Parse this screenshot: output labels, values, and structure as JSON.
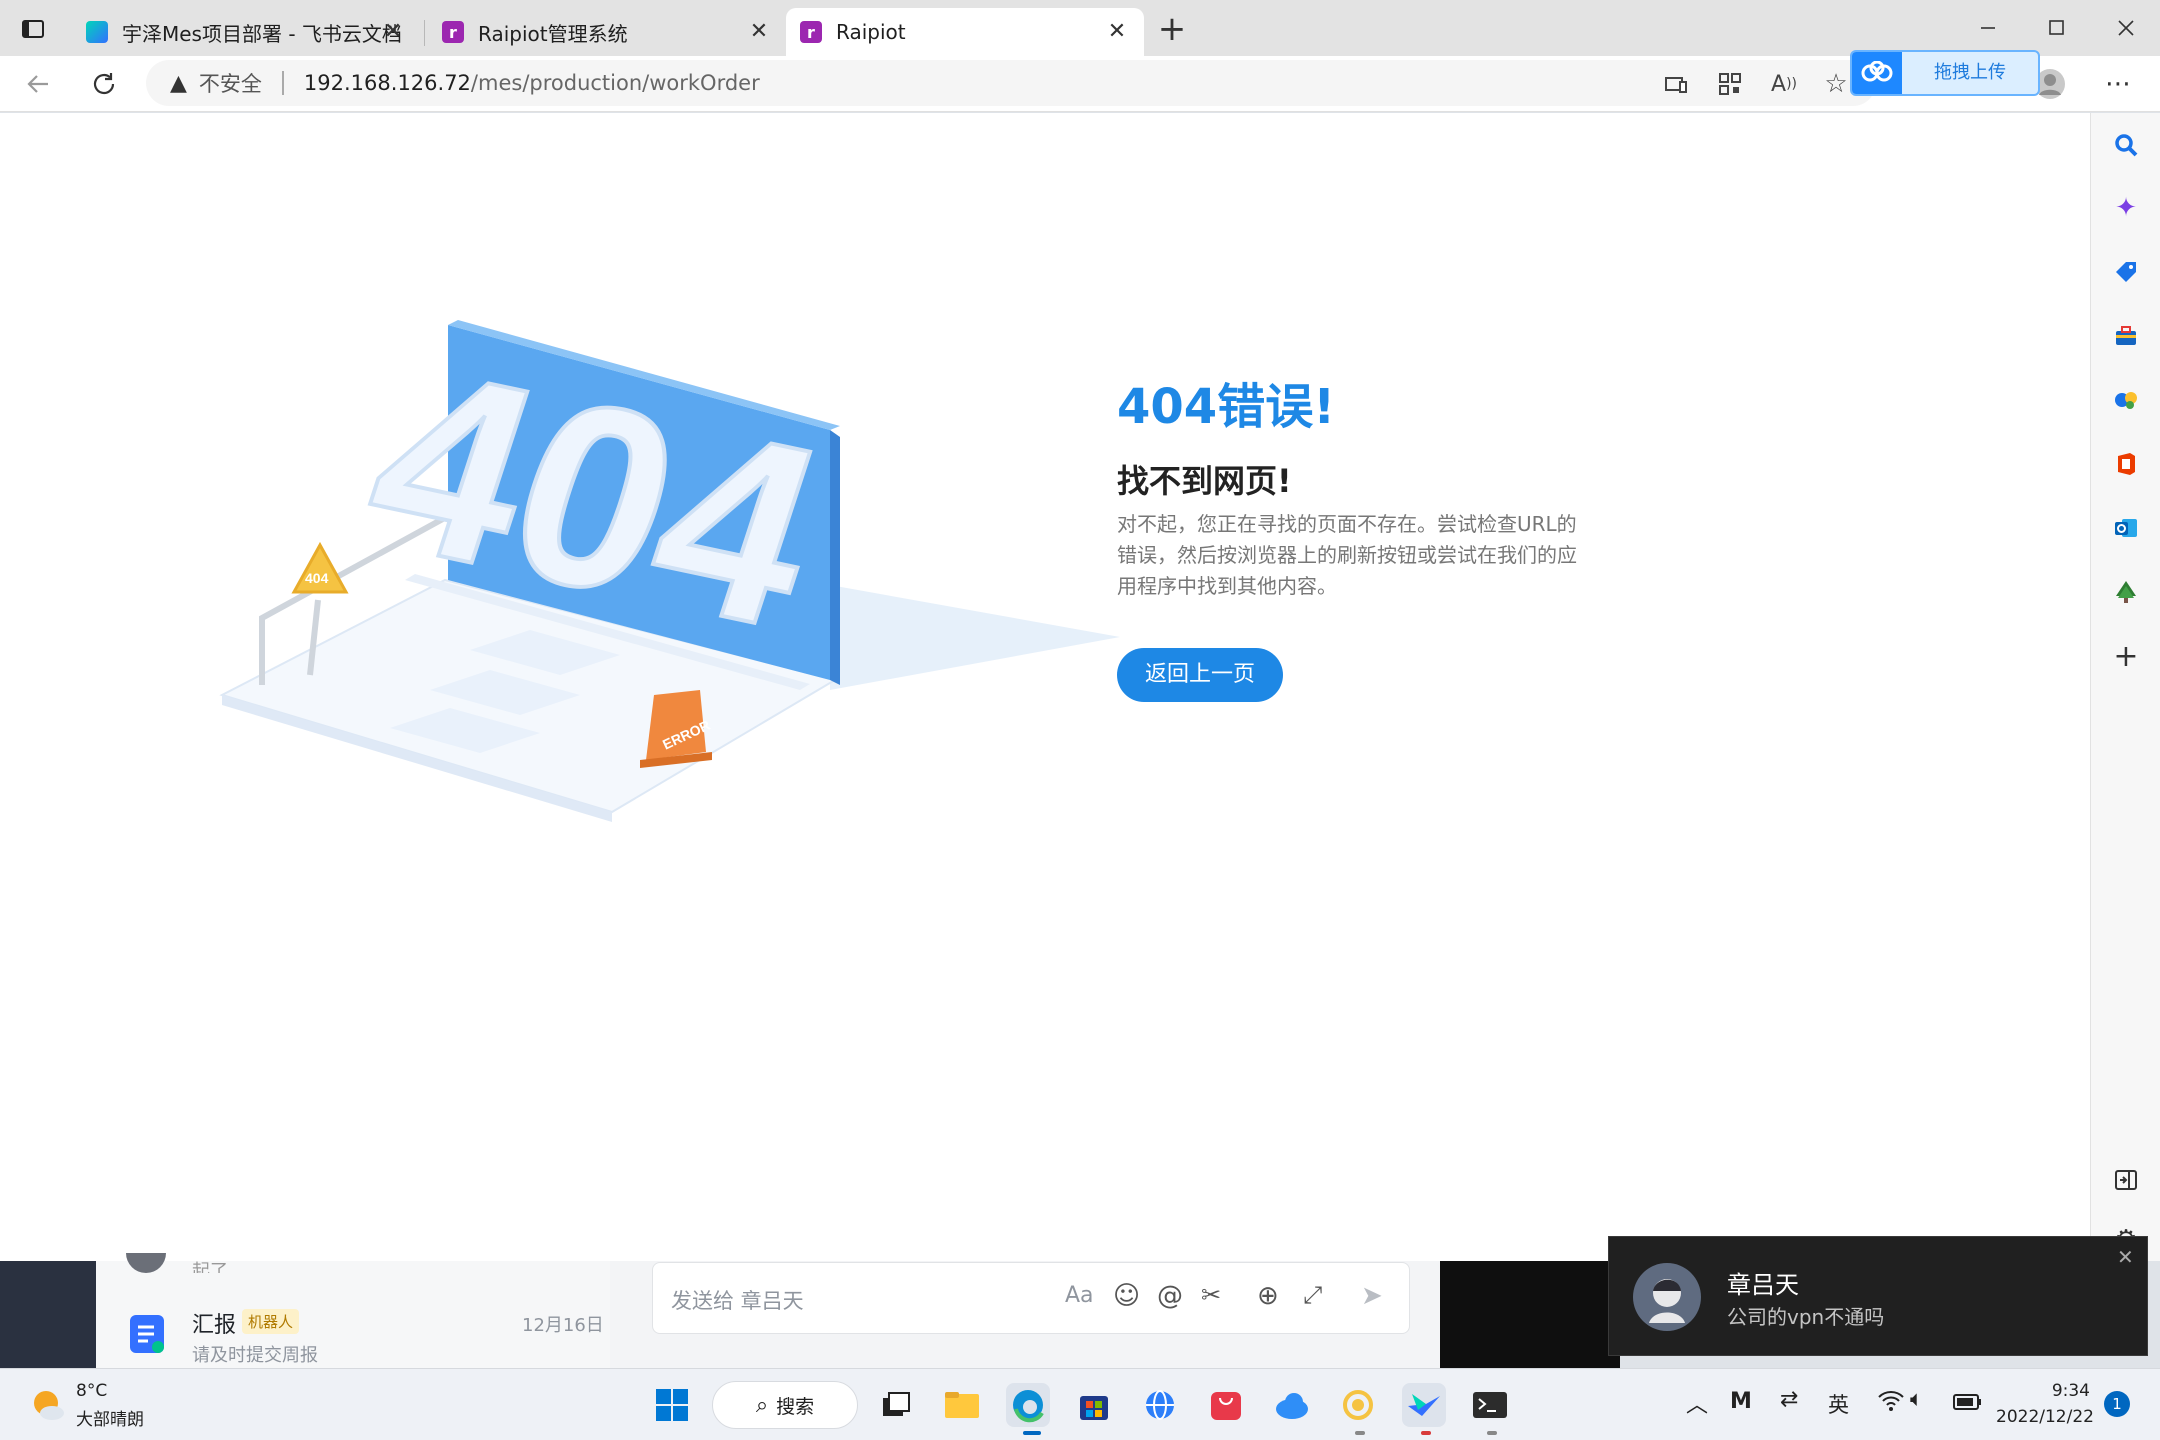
{
  "browser": {
    "tabs": [
      {
        "title": "宇泽Mes项目部署 - 飞书云文档",
        "icon": "feishu-docs-icon"
      },
      {
        "title": "Raipiot管理系统",
        "icon": "raipiot-icon"
      },
      {
        "title": "Raipiot",
        "icon": "raipiot-icon",
        "active": true
      }
    ],
    "new_tab": "+",
    "security_label": "不安全",
    "url_host": "192.168.126.72",
    "url_path": "/mes/production/workOrder",
    "upload_label": "拖拽上传",
    "window_controls": [
      "minimize",
      "maximize",
      "close"
    ]
  },
  "page": {
    "illustration_text": "404",
    "sign_text": "404",
    "error_tag": "ERROR",
    "title": "404错误!",
    "subtitle": "找不到网页!",
    "description": "对不起，您正在寻找的页面不存在。尝试检查URL的错误，然后按浏览器上的刷新按钮或尝试在我们的应用程序中找到其他内容。",
    "back_button": "返回上一页"
  },
  "chat": {
    "item_name": "汇报",
    "item_badge": "机器人",
    "item_date": "12月16日",
    "item_preview": "请及时提交周报",
    "input_placeholder": "发送给 章吕天",
    "partial_text": "起了"
  },
  "notification": {
    "sender": "章吕天",
    "message": "公司的vpn不通吗"
  },
  "taskbar": {
    "weather_temp": "8°C",
    "weather_desc": "大部晴朗",
    "search_label": "搜索",
    "ime": "英",
    "time": "9:34",
    "date": "2022/12/22",
    "notification_count": "1"
  },
  "colors": {
    "accent": "#1e88e5",
    "illustration_blue": "#5aa7f0",
    "sign_yellow": "#f5c342",
    "error_orange": "#f0883e"
  }
}
